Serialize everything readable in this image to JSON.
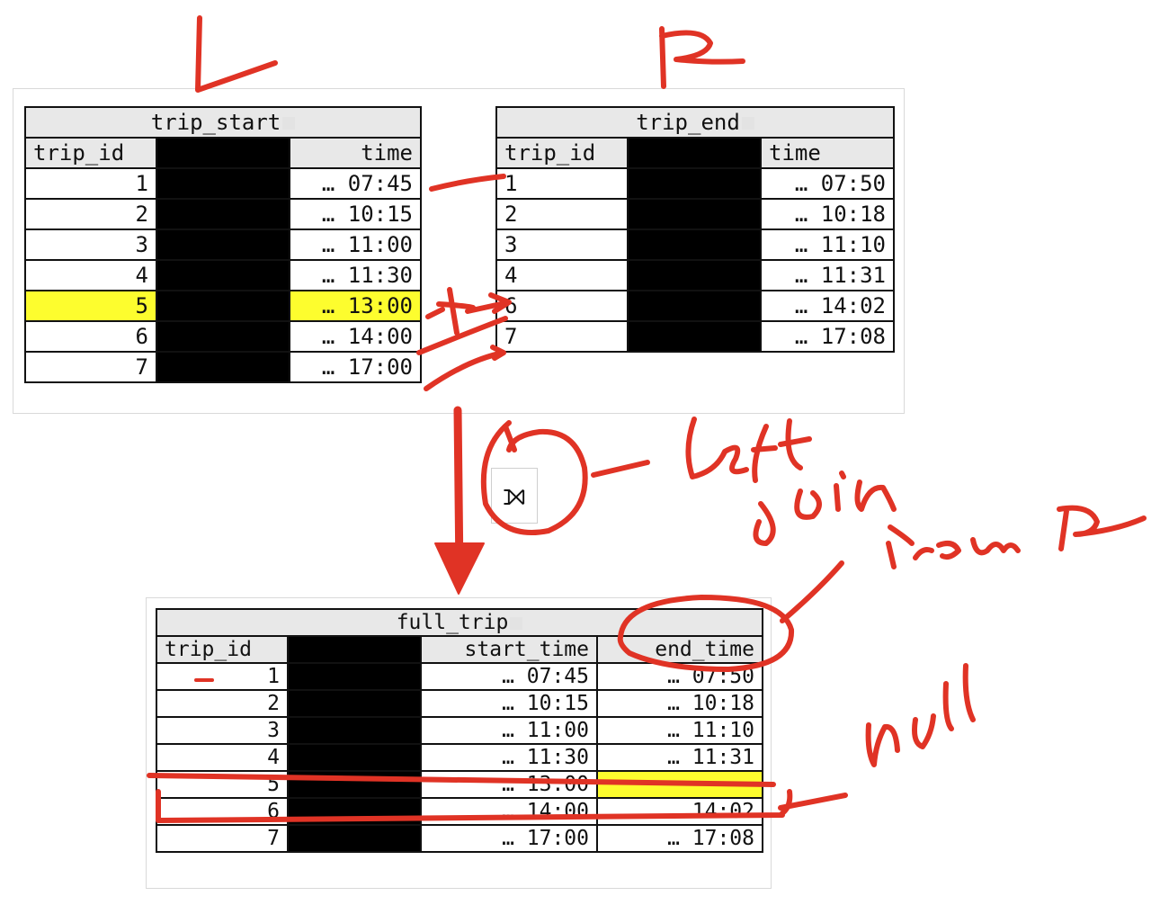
{
  "tables": {
    "trip_start": {
      "title": "trip_start",
      "col_id": "trip_id",
      "col_time": "time",
      "rows": [
        {
          "id": "1",
          "time": "… 07:45"
        },
        {
          "id": "2",
          "time": "… 10:15"
        },
        {
          "id": "3",
          "time": "… 11:00"
        },
        {
          "id": "4",
          "time": "… 11:30"
        },
        {
          "id": "5",
          "time": "… 13:00"
        },
        {
          "id": "6",
          "time": "… 14:00"
        },
        {
          "id": "7",
          "time": "… 17:00"
        }
      ]
    },
    "trip_end": {
      "title": "trip_end",
      "col_id": "trip_id",
      "col_time": "time",
      "rows": [
        {
          "id": "1",
          "time": "… 07:50"
        },
        {
          "id": "2",
          "time": "… 10:18"
        },
        {
          "id": "3",
          "time": "… 11:10"
        },
        {
          "id": "4",
          "time": "… 11:31"
        },
        {
          "id": "6",
          "time": "… 14:02"
        },
        {
          "id": "7",
          "time": "… 17:08"
        }
      ]
    },
    "full_trip": {
      "title": "full_trip",
      "col_id": "trip_id",
      "col_start": "start_time",
      "col_end": "end_time",
      "rows": [
        {
          "id": "1",
          "start": "… 07:45",
          "end": "… 07:50"
        },
        {
          "id": "2",
          "start": "… 10:15",
          "end": "… 10:18"
        },
        {
          "id": "3",
          "start": "… 11:00",
          "end": "… 11:10"
        },
        {
          "id": "4",
          "start": "… 11:30",
          "end": "… 11:31"
        },
        {
          "id": "5",
          "start": "… 13:00",
          "end": ""
        },
        {
          "id": "6",
          "start": "… 14:00",
          "end": "… 14:02"
        },
        {
          "id": "7",
          "start": "… 17:00",
          "end": "… 17:08"
        }
      ]
    }
  },
  "join_symbol": "⟕",
  "annotations": {
    "left_label": "L",
    "right_label": "R",
    "join_note_line1": "Left",
    "join_note_line2": "Join",
    "from_note": "From R",
    "null_note": "null"
  },
  "colors": {
    "highlight": "#fdfd2e",
    "ink": "#e03325",
    "redaction": "#000000"
  }
}
